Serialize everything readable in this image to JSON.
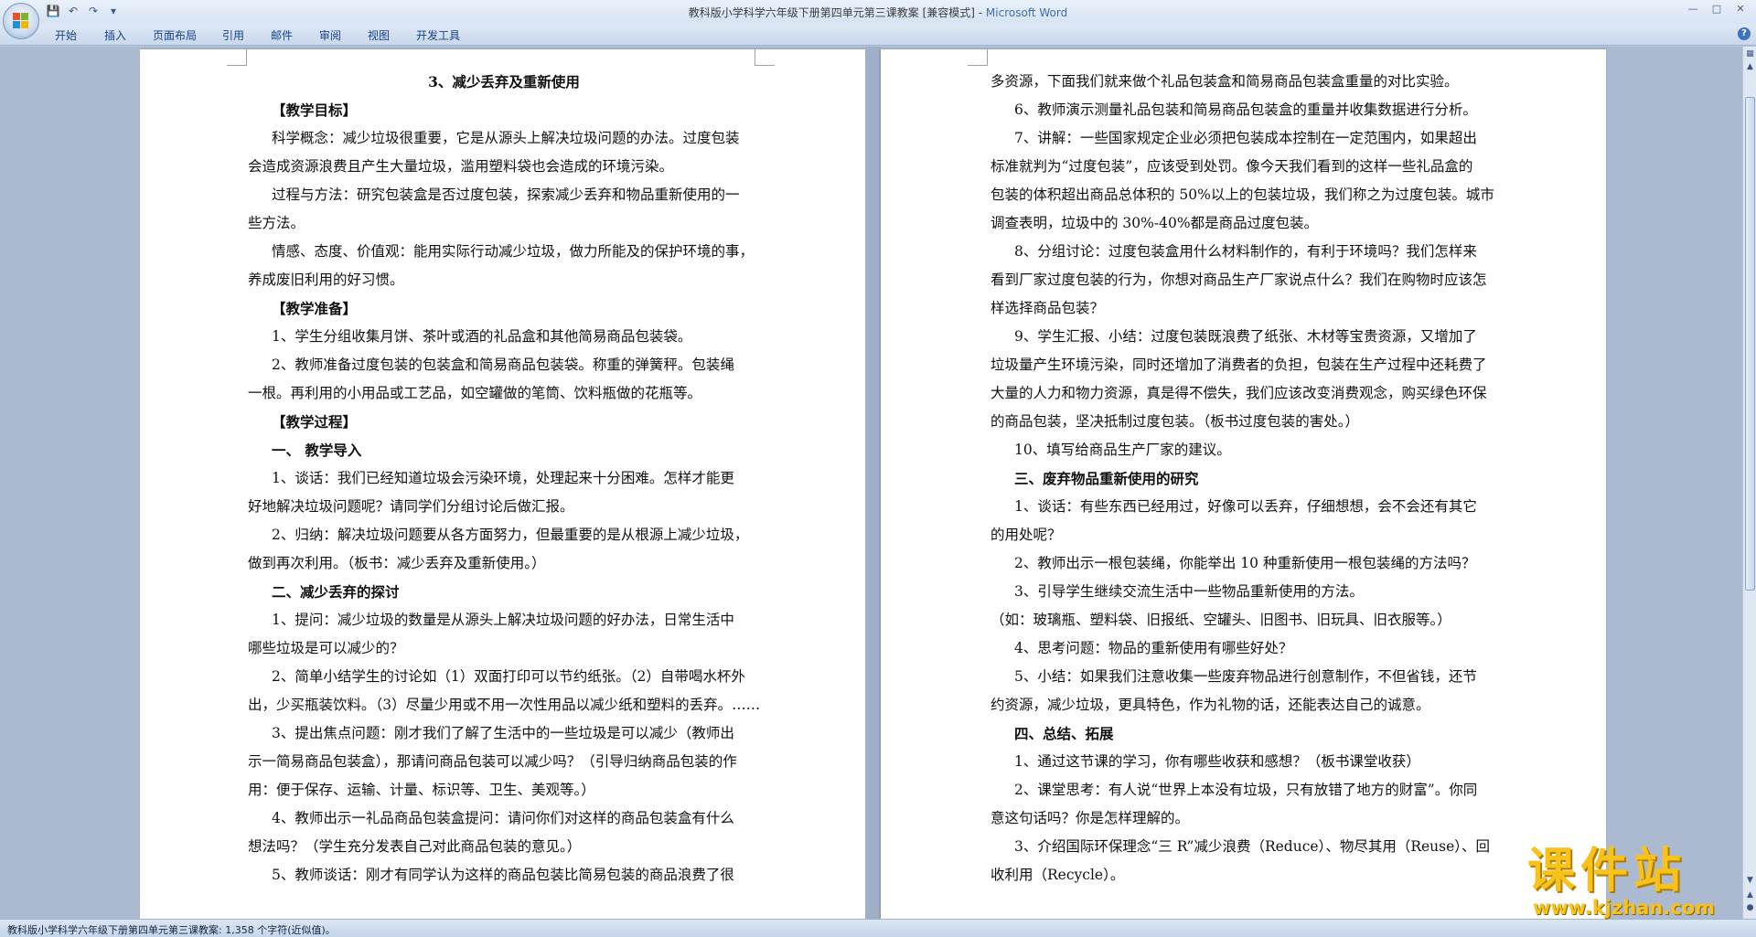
{
  "window": {
    "title_doc": "教科版小学科学六年级下册第四单元第三课教案 [兼容模式] - ",
    "title_app": "Microsoft Word"
  },
  "ribbon": {
    "tabs": [
      "开始",
      "插入",
      "页面布局",
      "引用",
      "邮件",
      "审阅",
      "视图",
      "开发工具"
    ]
  },
  "status_bar": {
    "text": "教科版小学科学六年级下册第四单元第三课教案: 1,358 个字符(近似值)。"
  },
  "watermark": {
    "big": "课件站",
    "small": "www.kjzhan.com"
  },
  "left_page": {
    "lines": [
      "3、减少丢弃及重新使用",
      "【教学目标】",
      "科学概念：减少垃圾很重要，它是从源头上解决垃圾问题的办法。过度包装",
      "会造成资源浪费且产生大量垃圾，滥用塑料袋也会造成的环境污染。",
      "过程与方法：研究包装盒是否过度包装，探索减少丢弃和物品重新使用的一",
      "些方法。",
      "情感、态度、价值观：能用实际行动减少垃圾，做力所能及的保护环境的事，",
      "养成废旧利用的好习惯。",
      "【教学准备】",
      "1、学生分组收集月饼、茶叶或酒的礼品盒和其他简易商品包装袋。",
      "2、教师准备过度包装的包装盒和简易商品包装袋。称重的弹簧秤。包装绳",
      "一根。再利用的小用品或工艺品，如空罐做的笔筒、饮料瓶做的花瓶等。",
      "【教学过程】",
      "一、 教学导入",
      "1、谈话：我们已经知道垃圾会污染环境，处理起来十分困难。怎样才能更",
      "好地解决垃圾问题呢？请同学们分组讨论后做汇报。",
      "2、归纳：解决垃圾问题要从各方面努力，但最重要的是从根源上减少垃圾，",
      "做到再次利用。（板书：减少丢弃及重新使用。）",
      "二、减少丢弃的探讨",
      "1、提问：减少垃圾的数量是从源头上解决垃圾问题的好办法，日常生活中",
      "哪些垃圾是可以减少的？",
      "2、简单小结学生的讨论如（1）双面打印可以节约纸张。（2）自带喝水杯外",
      "出，少买瓶装饮料。（3）尽量少用或不用一次性用品以减少纸和塑料的丢弃。……",
      "3、提出焦点问题：刚才我们了解了生活中的一些垃圾是可以减少（教师出",
      "示一简易商品包装盒），那请问商品包装可以减少吗？（引导归纳商品包装的作",
      "用：便于保存、运输、计量、标识等、卫生、美观等。）",
      "4、教师出示一礼品商品包装盒提问：请问你们对这样的商品包装盒有什么",
      "想法吗？（学生充分发表自己对此商品包装的意见。）",
      "5、教师谈话：刚才有同学认为这样的商品包装比简易包装的商品浪费了很"
    ]
  },
  "right_page": {
    "lines": [
      "多资源，下面我们就来做个礼品包装盒和简易商品包装盒重量的对比实验。",
      "6、教师演示测量礼品包装和简易商品包装盒的重量并收集数据进行分析。",
      "7、讲解：一些国家规定企业必须把包装成本控制在一定范围内，如果超出",
      "标准就判为“过度包装”，应该受到处罚。像今天我们看到的这样一些礼品盒的",
      "包装的体积超出商品总体积的 50%以上的包装垃圾，我们称之为过度包装。城市",
      "调查表明，垃圾中的 30%-40%都是商品过度包装。",
      "8、分组讨论：过度包装盒用什么材料制作的，有利于环境吗？我们怎样来",
      "看到厂家过度包装的行为，你想对商品生产厂家说点什么？我们在购物时应该怎",
      "样选择商品包装？",
      "9、学生汇报、小结：过度包装既浪费了纸张、木材等宝贵资源，又增加了",
      "垃圾量产生环境污染，同时还增加了消费者的负担，包装在生产过程中还耗费了",
      "大量的人力和物力资源，真是得不偿失，我们应该改变消费观念，购买绿色环保",
      "的商品包装，坚决抵制过度包装。（板书过度包装的害处。）",
      "10、填写给商品生产厂家的建议。",
      "三、废弃物品重新使用的研究",
      "1、谈话：有些东西已经用过，好像可以丢弃，仔细想想，会不会还有其它",
      "的用处呢？",
      "2、教师出示一根包装绳，你能举出 10 种重新使用一根包装绳的方法吗？",
      "3、引导学生继续交流生活中一些物品重新使用的方法。",
      "（如：玻璃瓶、塑料袋、旧报纸、空罐头、旧图书、旧玩具、旧衣服等。）",
      "4、思考问题：物品的重新使用有哪些好处？",
      "5、小结：如果我们注意收集一些废弃物品进行创意制作，不但省钱，还节",
      "约资源，减少垃圾，更具特色，作为礼物的话，还能表达自己的诚意。",
      "四、总结、拓展",
      "1、通过这节课的学习，你有哪些收获和感想？（板书课堂收获）",
      "2、课堂思考：有人说“世界上本没有垃圾，只有放错了地方的财富”。你同",
      "意这句话吗？你是怎样理解的。",
      "3、介绍国际环保理念“三 R”减少浪费（Reduce）、物尽其用（Reuse）、回",
      "收利用（Recycle）。"
    ]
  }
}
